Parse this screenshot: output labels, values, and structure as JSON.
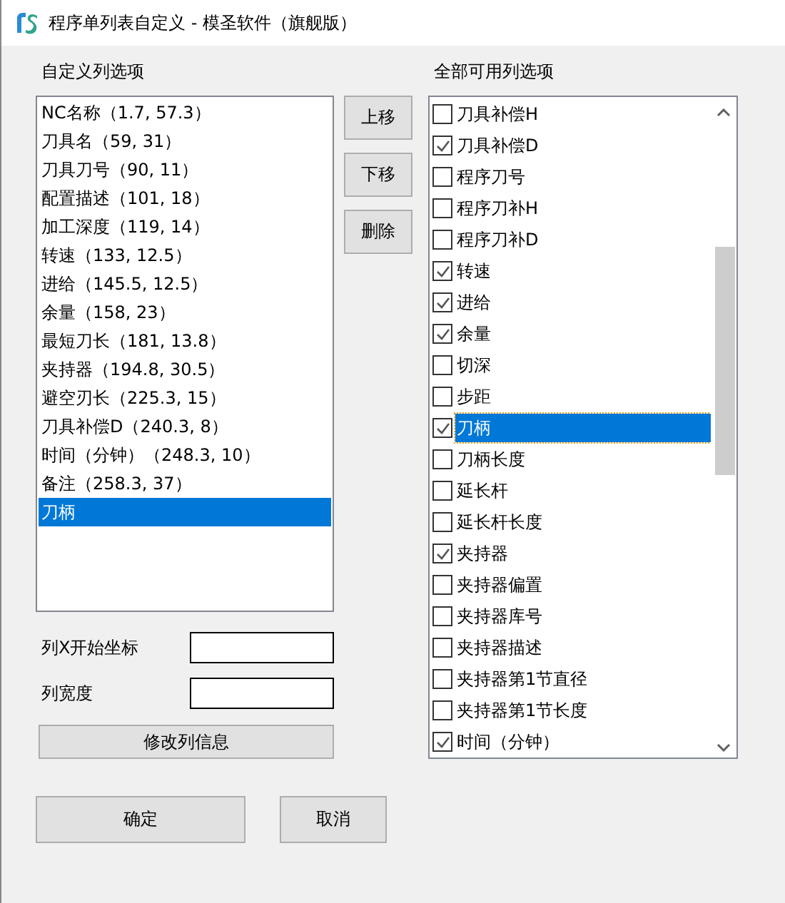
{
  "window": {
    "title": "程序单列表自定义 - 模圣软件（旗舰版）"
  },
  "custom_columns": {
    "label": "自定义列选项",
    "items": [
      {
        "text": "NC名称（1.7, 57.3）",
        "selected": false
      },
      {
        "text": "刀具名（59, 31）",
        "selected": false
      },
      {
        "text": "刀具刀号（90, 11）",
        "selected": false
      },
      {
        "text": "配置描述（101, 18）",
        "selected": false
      },
      {
        "text": "加工深度（119, 14）",
        "selected": false
      },
      {
        "text": "转速（133, 12.5）",
        "selected": false
      },
      {
        "text": "进给（145.5, 12.5）",
        "selected": false
      },
      {
        "text": "余量（158, 23）",
        "selected": false
      },
      {
        "text": "最短刀长（181, 13.8）",
        "selected": false
      },
      {
        "text": "夹持器（194.8, 30.5）",
        "selected": false
      },
      {
        "text": "避空刃长（225.3, 15）",
        "selected": false
      },
      {
        "text": "刀具补偿D（240.3, 8）",
        "selected": false
      },
      {
        "text": "时间（分钟）（248.3, 10）",
        "selected": false
      },
      {
        "text": "备注（258.3, 37）",
        "selected": false
      },
      {
        "text": "刀柄",
        "selected": true
      }
    ]
  },
  "side_buttons": [
    "上移",
    "下移",
    "删除"
  ],
  "all_columns": {
    "label": "全部可用列选项",
    "items": [
      {
        "text": "刀具补偿H",
        "checked": false,
        "selected": false
      },
      {
        "text": "刀具补偿D",
        "checked": true,
        "selected": false
      },
      {
        "text": "程序刀号",
        "checked": false,
        "selected": false
      },
      {
        "text": "程序刀补H",
        "checked": false,
        "selected": false
      },
      {
        "text": "程序刀补D",
        "checked": false,
        "selected": false
      },
      {
        "text": "转速",
        "checked": true,
        "selected": false
      },
      {
        "text": "进给",
        "checked": true,
        "selected": false
      },
      {
        "text": "余量",
        "checked": true,
        "selected": false
      },
      {
        "text": "切深",
        "checked": false,
        "selected": false
      },
      {
        "text": "步距",
        "checked": false,
        "selected": false
      },
      {
        "text": "刀柄",
        "checked": true,
        "selected": true
      },
      {
        "text": "刀柄长度",
        "checked": false,
        "selected": false
      },
      {
        "text": "延长杆",
        "checked": false,
        "selected": false
      },
      {
        "text": "延长杆长度",
        "checked": false,
        "selected": false
      },
      {
        "text": "夹持器",
        "checked": true,
        "selected": false
      },
      {
        "text": "夹持器偏置",
        "checked": false,
        "selected": false
      },
      {
        "text": "夹持器库号",
        "checked": false,
        "selected": false
      },
      {
        "text": "夹持器描述",
        "checked": false,
        "selected": false
      },
      {
        "text": "夹持器第1节直径",
        "checked": false,
        "selected": false
      },
      {
        "text": "夹持器第1节长度",
        "checked": false,
        "selected": false
      },
      {
        "text": "时间（分钟）",
        "checked": true,
        "selected": false
      }
    ]
  },
  "fields": [
    {
      "label": "列X开始坐标"
    },
    {
      "label": "列宽度"
    }
  ],
  "modify_button": "修改列信息",
  "buttons": [
    "确定",
    "取消"
  ]
}
